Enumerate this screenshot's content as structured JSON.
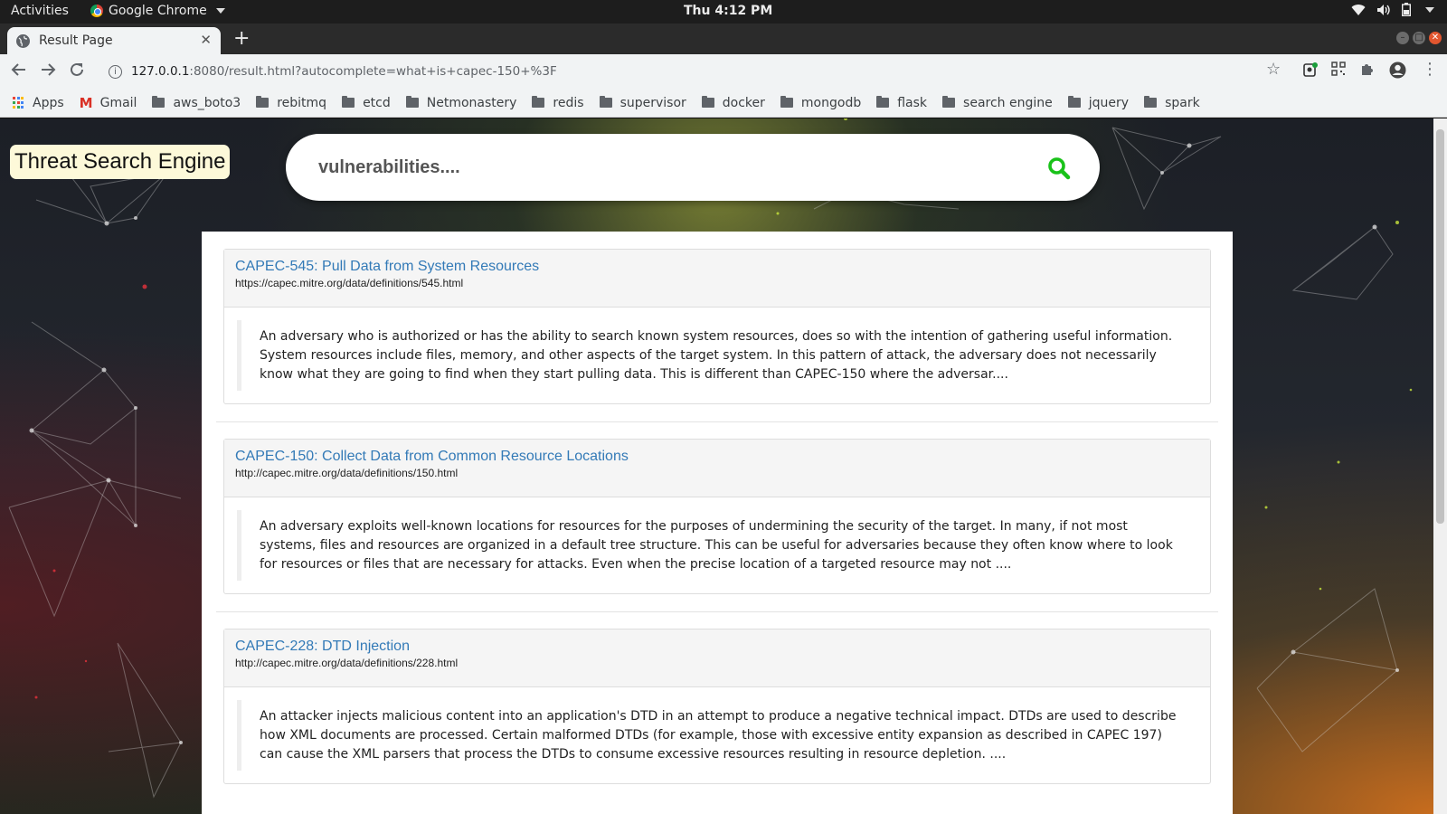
{
  "system": {
    "activities": "Activities",
    "app_name": "Google Chrome",
    "clock": "Thu  4:12 PM"
  },
  "browser": {
    "tab_title": "Result Page",
    "url_host": "127.0.0.1",
    "url_rest": ":8080/result.html?autocomplete=what+is+capec-150+%3F"
  },
  "bookmarks": [
    {
      "label": "Apps",
      "icon": "apps-grid-icon"
    },
    {
      "label": "Gmail",
      "icon": "gmail-icon"
    },
    {
      "label": "aws_boto3",
      "icon": "folder-icon"
    },
    {
      "label": "rebitmq",
      "icon": "folder-icon"
    },
    {
      "label": "etcd",
      "icon": "folder-icon"
    },
    {
      "label": "Netmonastery",
      "icon": "folder-icon"
    },
    {
      "label": "redis",
      "icon": "folder-icon"
    },
    {
      "label": "supervisor",
      "icon": "folder-icon"
    },
    {
      "label": "docker",
      "icon": "folder-icon"
    },
    {
      "label": "mongodb",
      "icon": "folder-icon"
    },
    {
      "label": "flask",
      "icon": "folder-icon"
    },
    {
      "label": "search engine",
      "icon": "folder-icon"
    },
    {
      "label": "jquery",
      "icon": "folder-icon"
    },
    {
      "label": "spark",
      "icon": "folder-icon"
    }
  ],
  "page": {
    "brand": "Threat Search Engine",
    "search_placeholder": "vulnerabilities....",
    "accent_color": "#19c219",
    "link_color": "#337ab7",
    "results": [
      {
        "title": "CAPEC-545: Pull Data from System Resources",
        "url": "https://capec.mitre.org/data/definitions/545.html",
        "snippet": "An adversary who is authorized or has the ability to search known system resources, does so with the intention of gathering useful information. System resources include files, memory, and other aspects of the target system. In this pattern of attack, the adversary does not necessarily know what they are going to find when they start pulling data. This is different than CAPEC-150 where the adversar...."
      },
      {
        "title": "CAPEC-150: Collect Data from Common Resource Locations",
        "url": "http://capec.mitre.org/data/definitions/150.html",
        "snippet": "An adversary exploits well-known locations for resources for the purposes of undermining the security of the target. In many, if not most systems, files and resources are organized in a default tree structure. This can be useful for adversaries because they often know where to look for resources or files that are necessary for attacks. Even when the precise location of a targeted resource may not ...."
      },
      {
        "title": "CAPEC-228: DTD Injection",
        "url": "http://capec.mitre.org/data/definitions/228.html",
        "snippet": "An attacker injects malicious content into an application's DTD in an attempt to produce a negative technical impact. DTDs are used to describe how XML documents are processed. Certain malformed DTDs (for example, those with excessive entity expansion as described in CAPEC 197) can cause the XML parsers that process the DTDs to consume excessive resources resulting in resource depletion. ...."
      }
    ]
  }
}
